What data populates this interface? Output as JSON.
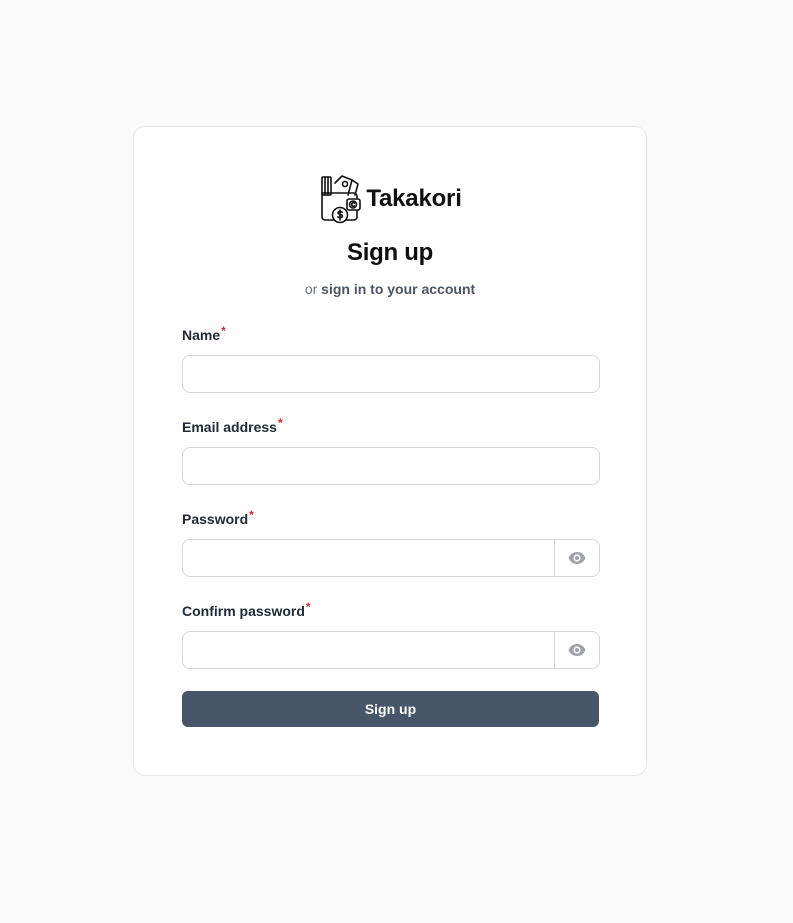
{
  "brand": {
    "name": "Takakori",
    "logo_icon": "wallet-money-icon"
  },
  "heading": {
    "title": "Sign up"
  },
  "subheading": {
    "prefix": "or",
    "link_label": "sign in to your account"
  },
  "form": {
    "required_marker": "*",
    "name": {
      "label": "Name",
      "value": ""
    },
    "email": {
      "label": "Email address",
      "value": ""
    },
    "password": {
      "label": "Password",
      "value": "",
      "toggle_icon": "eye-icon"
    },
    "confirm_password": {
      "label": "Confirm password",
      "value": "",
      "toggle_icon": "eye-icon"
    },
    "submit_label": "Sign up"
  },
  "colors": {
    "page_bg": "#fafafa",
    "card_bg": "#ffffff",
    "primary_button": "#475569",
    "required": "#dc2626",
    "link": "#4b5563"
  }
}
